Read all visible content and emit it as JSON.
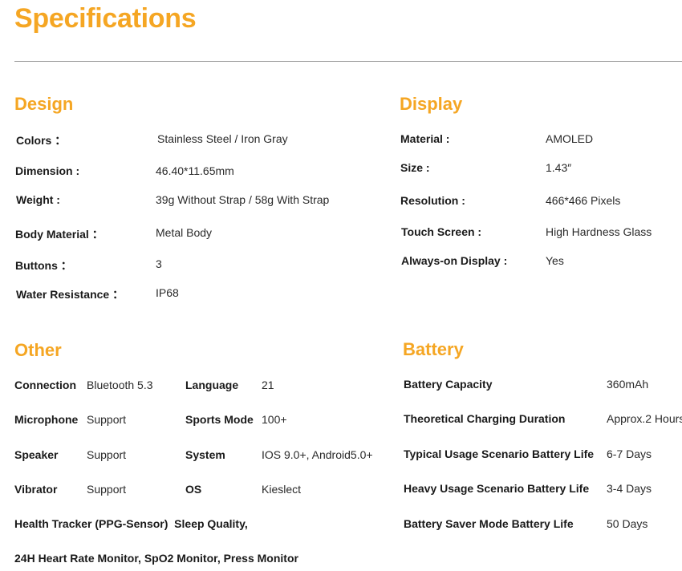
{
  "page": {
    "title": "Specifications"
  },
  "design": {
    "heading": "Design",
    "rows": [
      {
        "label": "Colors ：",
        "value": "Stainless Steel / Iron Gray"
      },
      {
        "label": "Dimension :",
        "value": "46.40*11.65mm"
      },
      {
        "label": "Weight :",
        "value": "39g Without Strap / 58g With Strap"
      },
      {
        "label": "Body Material ：",
        "value": "Metal Body"
      },
      {
        "label": "Buttons ：",
        "value": "3"
      },
      {
        "label": "Water Resistance ：",
        "value": "IP68"
      }
    ]
  },
  "display": {
    "heading": "Display",
    "rows": [
      {
        "label": "Material :",
        "value": "AMOLED"
      },
      {
        "label": "Size :",
        "value": "1.43″"
      },
      {
        "label": "Resolution :",
        "value": "466*466 Pixels"
      },
      {
        "label": "Touch Screen :",
        "value": "High Hardness Glass"
      },
      {
        "label": "Always-on Display :",
        "value": "Yes"
      }
    ]
  },
  "other": {
    "heading": "Other",
    "rows": [
      {
        "label1": "Connection",
        "value1": "Bluetooth 5.3",
        "label2": "Language",
        "value2": "21"
      },
      {
        "label1": "Microphone",
        "value1": "Support",
        "label2": "Sports Mode",
        "value2": "100+"
      },
      {
        "label1": "Speaker",
        "value1": "Support",
        "label2": "System",
        "value2": "IOS 9.0+, Android5.0+"
      },
      {
        "label1": "Vibrator",
        "value1": "Support",
        "label2": "OS",
        "value2": "Kieslect"
      }
    ],
    "health_line1": "Health Tracker (PPG-Sensor)  Sleep Quality,",
    "health_line2": "24H Heart Rate Monitor, SpO2 Monitor, Press Monitor"
  },
  "battery": {
    "heading": "Battery",
    "rows": [
      {
        "label": "Battery Capacity",
        "value": "360mAh"
      },
      {
        "label": "Theoretical Charging Duration",
        "value": "Approx.2 Hours"
      },
      {
        "label": "Typical Usage Scenario Battery Life",
        "value": "6-7 Days"
      },
      {
        "label": "Heavy Usage Scenario Battery Life",
        "value": "3-4 Days"
      },
      {
        "label": "Battery Saver Mode Battery Life",
        "value": "50 Days"
      }
    ]
  }
}
